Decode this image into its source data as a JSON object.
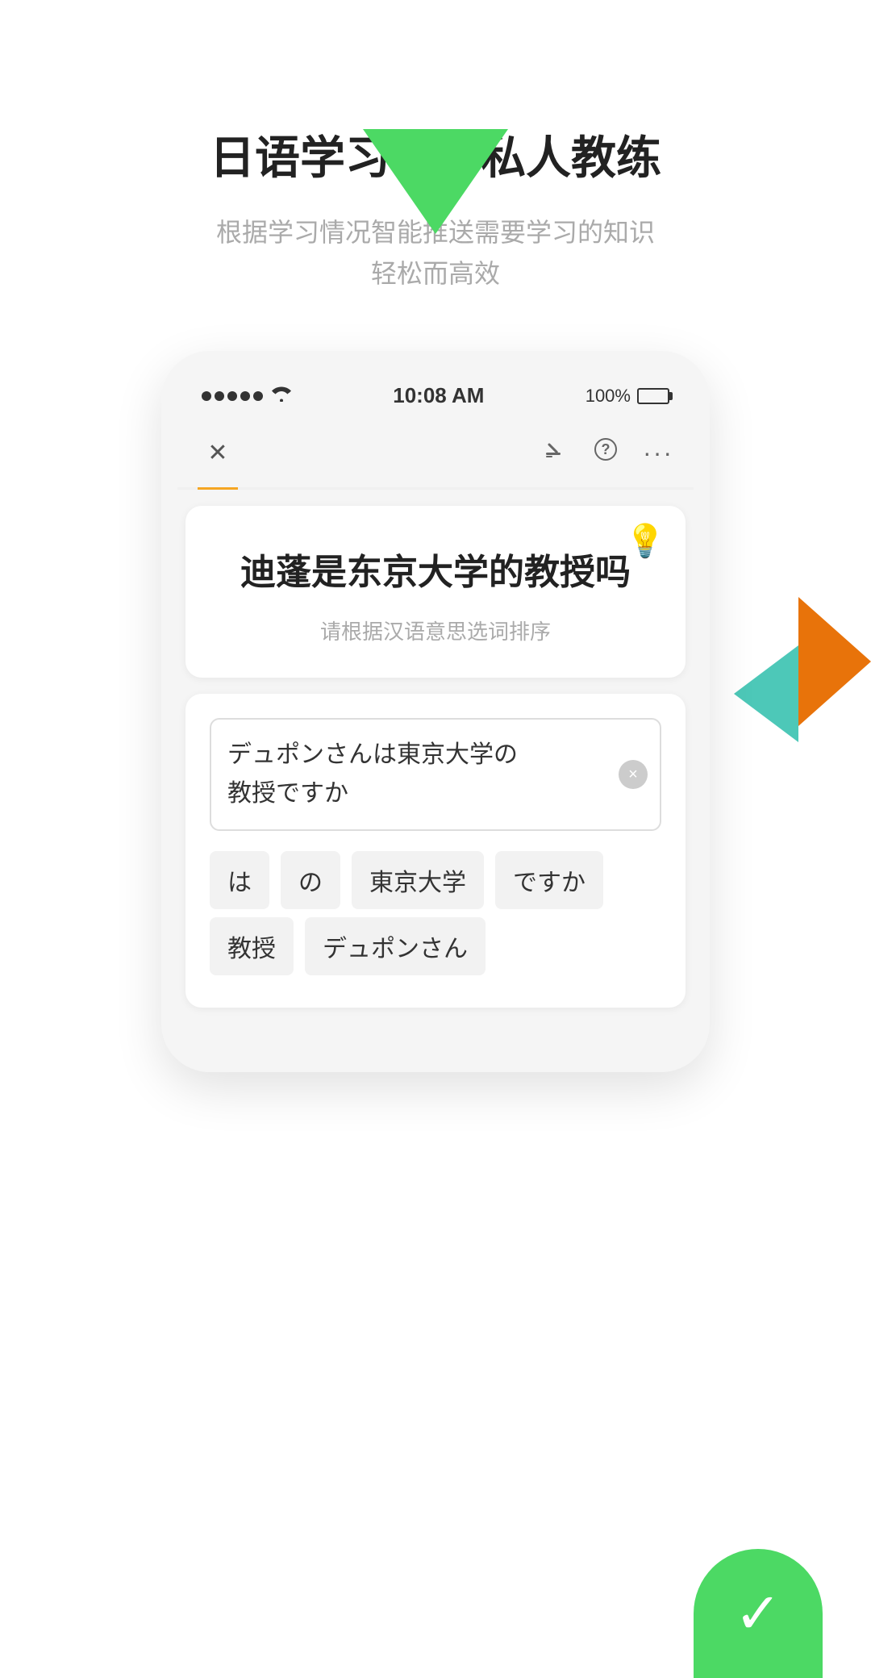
{
  "app": {
    "title": "日语学习中的私人教练",
    "subtitle": "根据学习情况智能推送需要学习的知识\n轻松而高效"
  },
  "statusBar": {
    "time": "10:08 AM",
    "battery": "100%"
  },
  "nav": {
    "closeIcon": "✕",
    "editIcon": "✏",
    "helpIcon": "?",
    "moreIcon": "⋯"
  },
  "question": {
    "text": "迪蓬是东京大学的教授吗",
    "hintIcon": "💡",
    "hint": "请根据汉语意思选词排序"
  },
  "answer": {
    "inputText": "デュポンさんは東京大学の\n教授ですか",
    "clearIcon": "×"
  },
  "wordChips": {
    "row1": [
      "は",
      "の",
      "東京大学",
      "ですか"
    ],
    "row2": [
      "教授",
      "デュポンさん"
    ]
  },
  "colors": {
    "green": "#4cd964",
    "orange": "#f5a623",
    "teal": "#4dc8b8",
    "darkOrange": "#e8730a"
  }
}
